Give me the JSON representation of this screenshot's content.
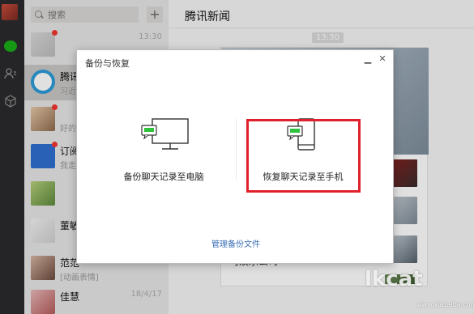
{
  "search": {
    "placeholder": "搜索"
  },
  "add_button": "+",
  "chats": [
    {
      "name": "",
      "preview": "",
      "time": "13:30",
      "unread": true
    },
    {
      "name": "腾讯",
      "preview": "习近",
      "time": "",
      "unread": false
    },
    {
      "name": "",
      "preview": "好的",
      "time": "",
      "unread": true
    },
    {
      "name": "订阅",
      "preview": "我走",
      "time": "",
      "unread": true
    },
    {
      "name": "",
      "preview": "",
      "time": "",
      "unread": false
    },
    {
      "name": "董敏",
      "preview": "",
      "time": "",
      "unread": false
    },
    {
      "name": "范范",
      "preview": "[动画表情]",
      "time": "",
      "unread": false
    },
    {
      "name": "佳慧",
      "preview": "",
      "time": "18/4/17",
      "unread": false
    }
  ],
  "conversation": {
    "title": "腾讯新闻",
    "timestamp": "13:30",
    "card_footer": "马娱乐公司"
  },
  "dialog": {
    "title": "备份与恢复",
    "min": "▁",
    "close": "✕",
    "backup_label": "备份聊天记录至电脑",
    "restore_label": "恢复聊天记录至手机",
    "manage_link": "管理备份文件"
  },
  "watermark": {
    "text": "lkcat",
    "url": "www.xiazaiba.com"
  },
  "colors": {
    "highlight": "#e0212b",
    "wechat_green": "#1aad19",
    "link": "#3a6db6"
  },
  "icons": [
    "chat-icon",
    "contacts-icon",
    "favorites-icon",
    "search-icon",
    "computer-icon",
    "phone-icon"
  ]
}
